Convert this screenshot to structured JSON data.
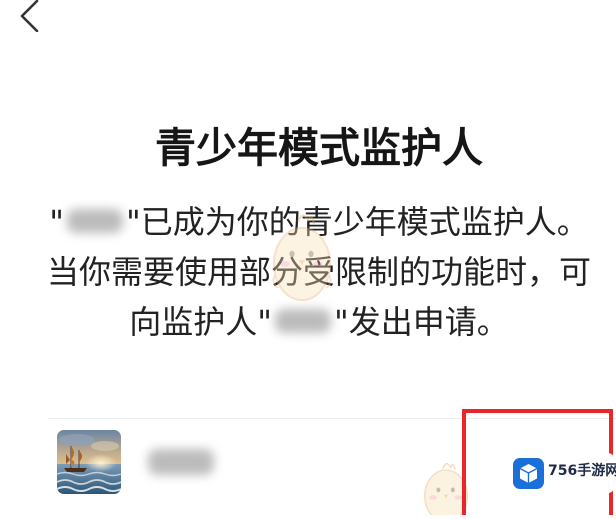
{
  "header": {
    "back_icon": "chevron-left-icon"
  },
  "page": {
    "title": "青少年模式监护人"
  },
  "message": {
    "line1_prefix": "\"",
    "line1_suffix": "\"已成为你的青少年模式监护人。",
    "line2": "当你需要使用部分受限制的功能时，可",
    "line3_prefix": "向监护人\"",
    "line3_suffix": "\"发出申请。"
  },
  "guardian": {
    "avatar_icon": "sailing-ship-painting"
  },
  "watermark": {
    "brand": "756手游网",
    "icon": "cube-icon",
    "mascot_icon": "chick-mascot-icon"
  },
  "colors": {
    "highlight": "#e8262b",
    "brand_blue": "#1b6fd8",
    "text": "#222222"
  }
}
